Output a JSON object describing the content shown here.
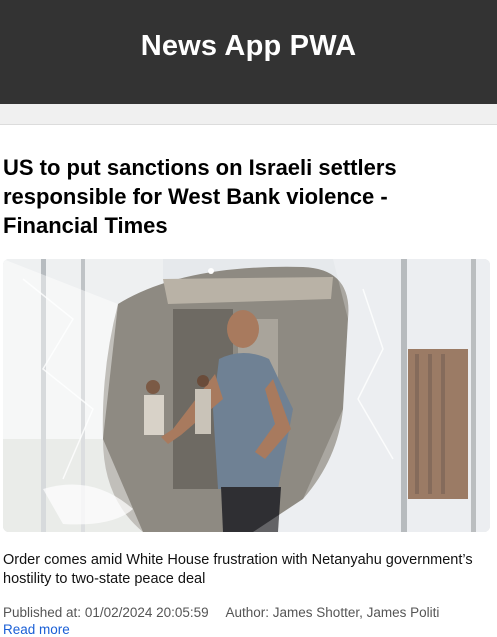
{
  "header": {
    "title": "News App PWA"
  },
  "article": {
    "headline": "US to put sanctions on Israeli settlers responsible for West Bank violence - Financial Times",
    "description": "Order comes amid White House frustration with Netanyahu government’s hostility to two-state peace deal",
    "published_label": "Published at:",
    "published_value": "01/02/2024 20:05:59",
    "author_label": "Author:",
    "author_value": "James Shotter, James Politi",
    "read_more": "Read more"
  },
  "colors": {
    "header_bg": "#333333",
    "header_text": "#ffffff",
    "link": "#1a5fd6"
  }
}
